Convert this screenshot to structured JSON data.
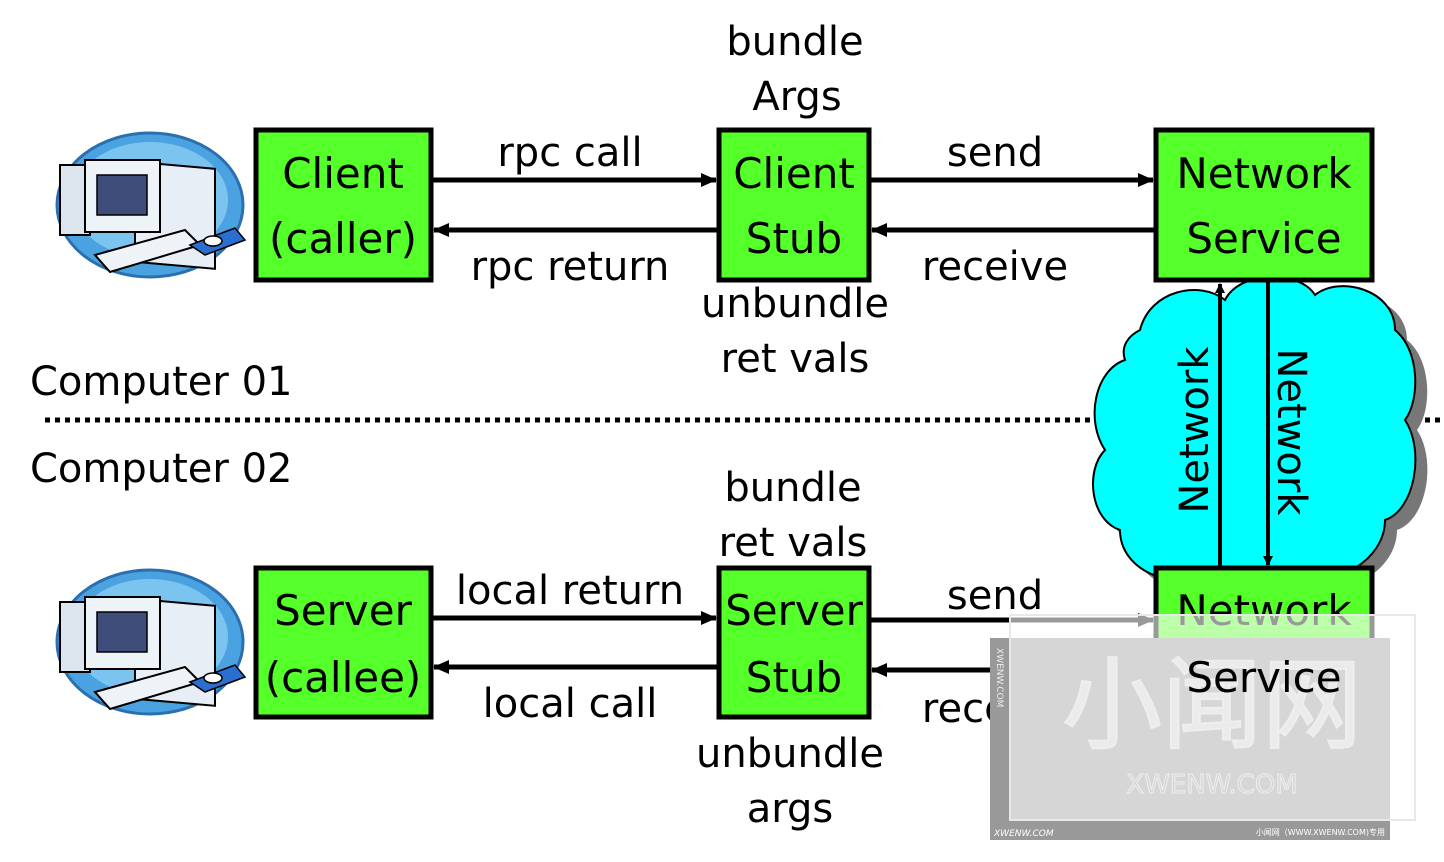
{
  "colors": {
    "box_fill": "#55ff2a",
    "cloud_fill": "#00ffff",
    "line": "#000000"
  },
  "computer_01": {
    "label": "Computer 01",
    "icon": "desktop-computer-icon",
    "client_box": [
      "Client",
      "(caller)"
    ],
    "client_stub_box": [
      "Client",
      "Stub"
    ],
    "network_service_box": [
      "Network",
      "Service"
    ],
    "rpc_call": "rpc call",
    "rpc_return": "rpc return",
    "send": "send",
    "receive": "receive",
    "bundle_args": [
      "bundle",
      "Args"
    ],
    "unbundle_ret_vals": [
      "unbundle",
      "ret vals"
    ]
  },
  "computer_02": {
    "label": "Computer 02",
    "icon": "desktop-computer-icon",
    "server_box": [
      "Server",
      "(callee)"
    ],
    "server_stub_box": [
      "Server",
      "Stub"
    ],
    "network_service_box": [
      "Network",
      "Service"
    ],
    "local_return": "local return",
    "local_call": "local call",
    "send": "send",
    "receive": "receive",
    "bundle_ret_vals": [
      "bundle",
      "ret vals"
    ],
    "unbundle_args": [
      "unbundle",
      "args"
    ]
  },
  "network": {
    "up_label": "Network",
    "down_label": "Network"
  },
  "watermark": {
    "big": "小闻网",
    "site": "XWENW.COM",
    "side": "XWENW.COM",
    "footer_left": "XWENW.COM",
    "footer_right": "小闻网（WWW.XWENW.COM)专用"
  }
}
